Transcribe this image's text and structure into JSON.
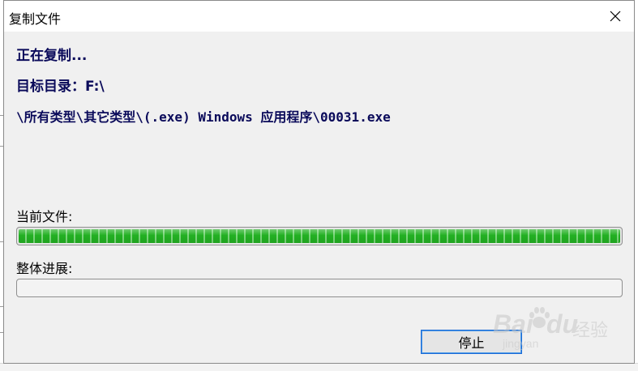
{
  "window": {
    "title": "复制文件"
  },
  "dialog": {
    "status": "正在复制...",
    "target_dir": "目标目录：F:\\",
    "current_path": "\\所有类型\\其它类型\\(.exe) Windows 应用程序\\00031.exe",
    "current_file_label": "当前文件:",
    "overall_label": "整体进展:",
    "current_progress": 1.0,
    "overall_progress": 0.0,
    "stop_label": "停止"
  },
  "watermark": {
    "brand_left": "Bai",
    "brand_right": "du",
    "brand_cn": "经验",
    "brand_sub": "jingyan"
  },
  "colors": {
    "progress_green": "#22b022",
    "text_navy": "#0a0a5a",
    "button_focus": "#1a6ad6"
  },
  "icons": {
    "close": "close-icon"
  }
}
